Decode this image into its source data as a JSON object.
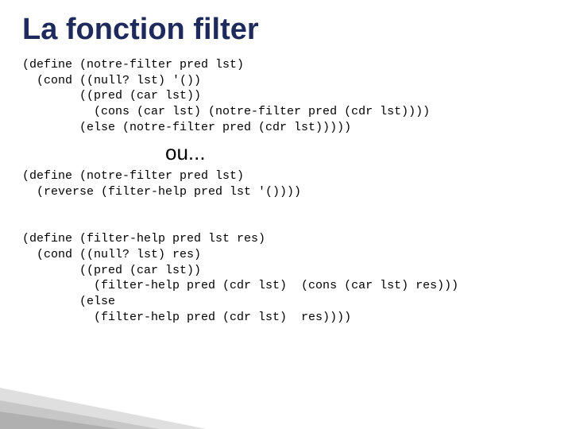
{
  "title": "La fonction filter",
  "code_block_1": "(define (notre-filter pred lst)\n  (cond ((null? lst) '())\n        ((pred (car lst))\n          (cons (car lst) (notre-filter pred (cdr lst))))\n        (else (notre-filter pred (cdr lst)))))",
  "separator": "ou...",
  "code_block_2": "(define (notre-filter pred lst)\n  (reverse (filter-help pred lst '())))\n\n\n(define (filter-help pred lst res)\n  (cond ((null? lst) res)\n        ((pred (car lst))\n          (filter-help pred (cdr lst)  (cons (car lst) res)))\n        (else\n          (filter-help pred (cdr lst)  res))))"
}
